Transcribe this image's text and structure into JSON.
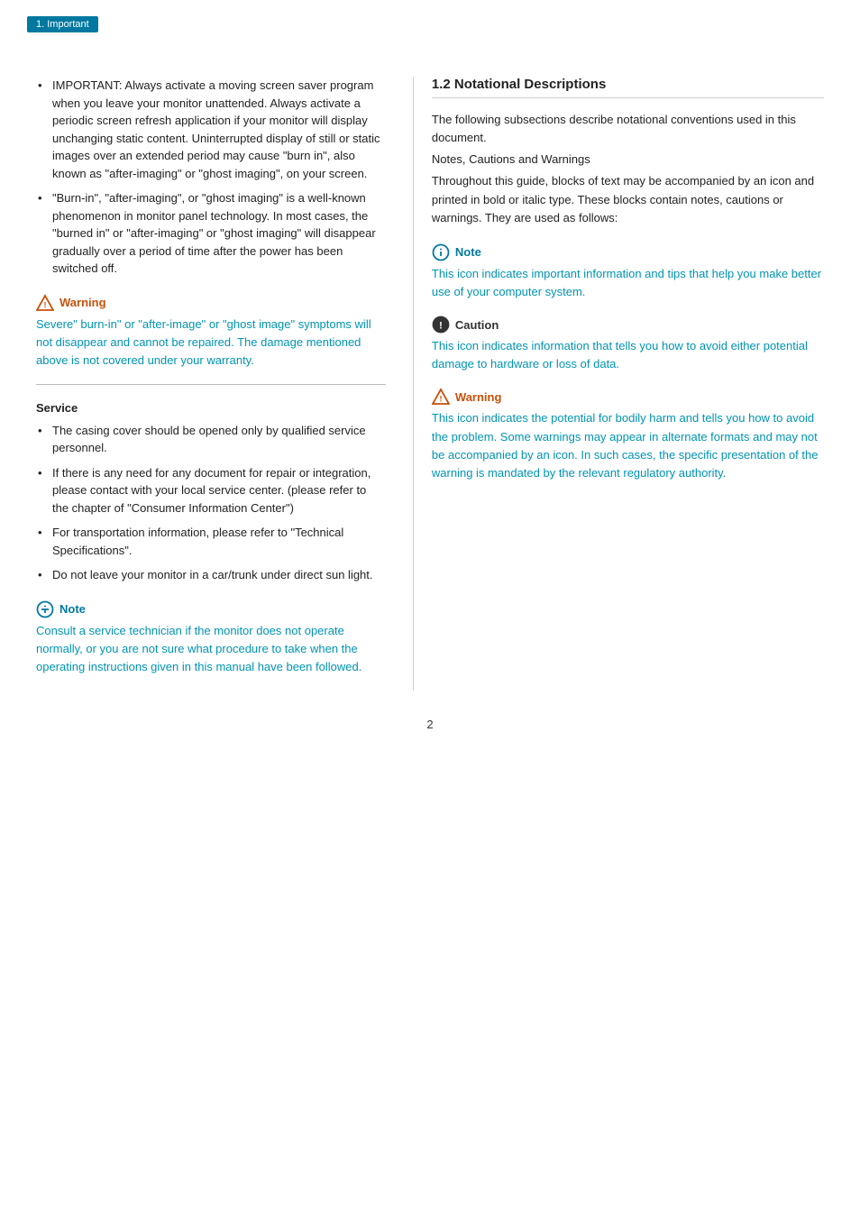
{
  "breadcrumb": {
    "label": "1. Important"
  },
  "left_column": {
    "bullets_top": [
      "IMPORTANT: Always activate a moving screen saver program when you leave your monitor unattended. Always activate a periodic screen refresh application if your monitor will display unchanging static content. Uninterrupted display of still or static images over an extended period may cause \"burn in\", also known as \"after-imaging\" or \"ghost imaging\", on your screen.",
      "\"Burn-in\", \"after-imaging\", or \"ghost imaging\" is a well-known phenomenon in monitor panel technology. In most cases, the \"burned in\" or \"after-imaging\" or \"ghost imaging\" will disappear gradually over a period of time after the power has been switched off."
    ],
    "warning_1": {
      "label": "Warning",
      "text": "Severe\" burn-in\" or \"after-image\" or \"ghost image\" symptoms will not disappear and cannot be repaired. The damage mentioned above is not covered under your warranty."
    },
    "service_heading": "Service",
    "service_bullets": [
      "The casing cover should be opened only by qualified service personnel.",
      "If there is any need for any document for repair or integration, please contact with your local service center. (please refer to the chapter of \"Consumer Information Center\")",
      "For transportation information, please refer to \"Technical Specifications\".",
      "Do not leave your monitor in a car/trunk under direct sun light."
    ],
    "note_1": {
      "label": "Note",
      "text": "Consult a service technician if the monitor does not operate normally, or you are not sure what procedure to take when the operating instructions given in this manual have been followed."
    }
  },
  "right_column": {
    "heading": "1.2 Notational Descriptions",
    "intro_lines": [
      "The following subsections describe notational conventions used in this document.",
      "Notes, Cautions and Warnings",
      "Throughout this guide, blocks of text may be accompanied by an icon and printed in bold or italic type. These blocks contain notes, cautions or warnings. They are used as follows:"
    ],
    "note": {
      "label": "Note",
      "text": "This icon indicates important information and tips that help you make better use of your computer system."
    },
    "caution": {
      "label": "Caution",
      "text": "This icon indicates information that tells you how to avoid either potential damage to hardware or loss of data."
    },
    "warning": {
      "label": "Warning",
      "text": "This icon indicates the potential for bodily harm and tells you how to avoid the problem. Some warnings may appear in alternate formats and may not be accompanied by an icon. In such cases, the specific presentation of the warning is mandated by the relevant regulatory authority."
    }
  },
  "page_number": "2"
}
